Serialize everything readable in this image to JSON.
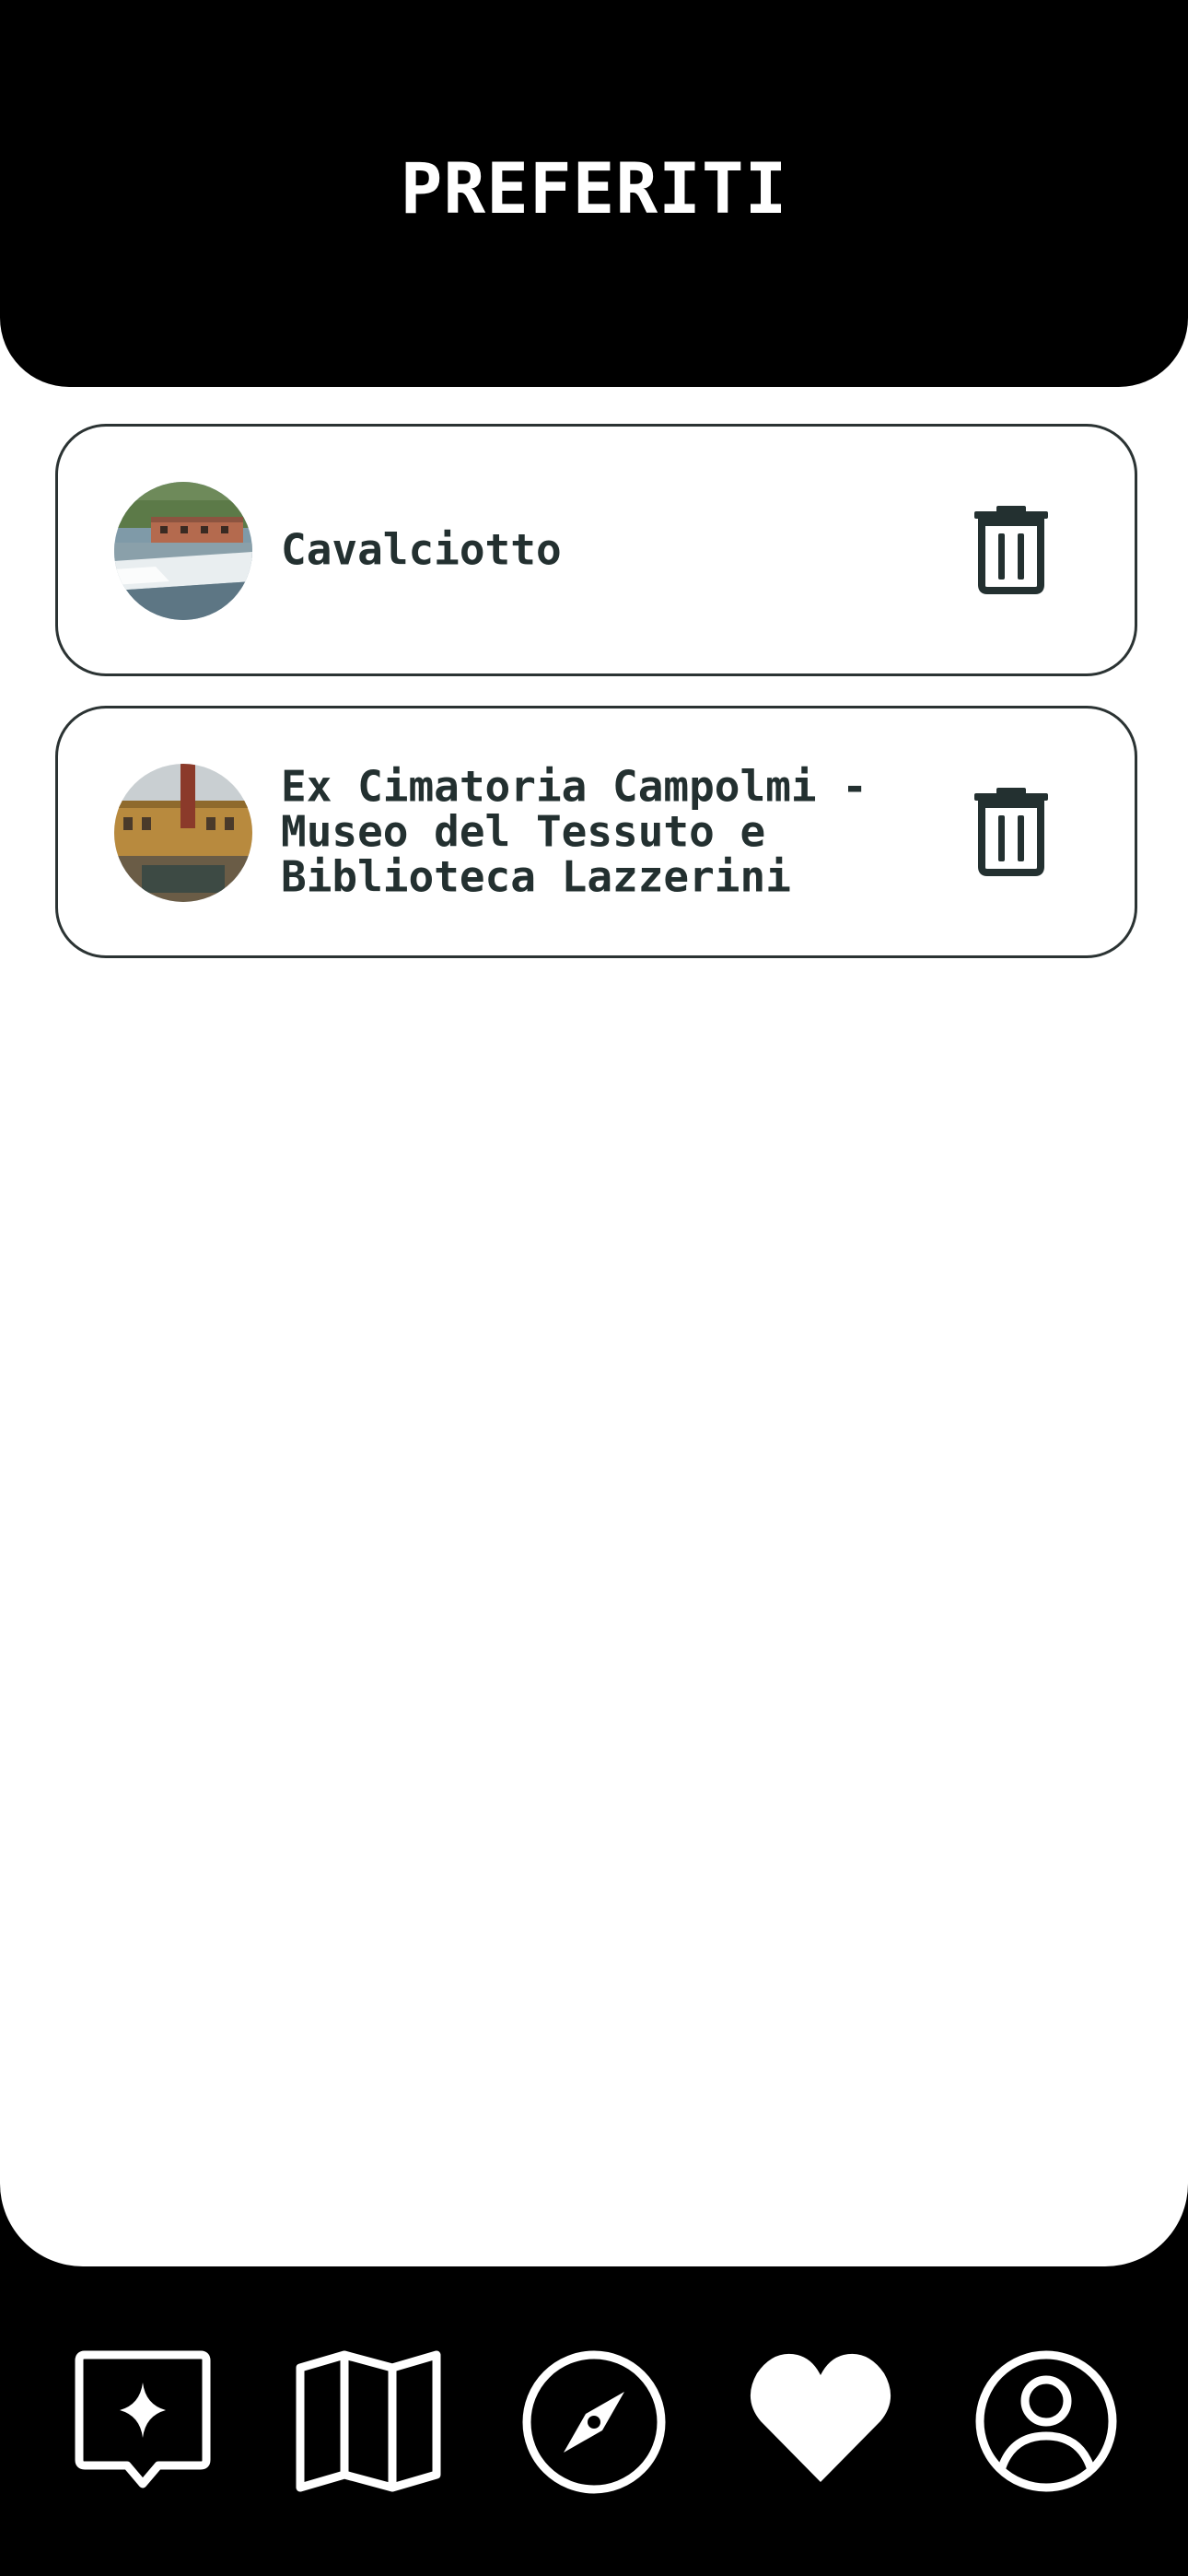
{
  "header": {
    "title": "PREFERITI"
  },
  "favorites": [
    {
      "name": "Cavalciotto",
      "thumbnail_icon": "photo-weir-river",
      "delete_icon": "trash-icon"
    },
    {
      "name": "Ex Cimatoria Campolmi - Museo del Tessuto e Biblioteca Lazzerini",
      "thumbnail_icon": "photo-factory-chimney",
      "delete_icon": "trash-icon"
    }
  ],
  "nav": {
    "items": [
      {
        "icon": "sparkle-chat-icon"
      },
      {
        "icon": "map-icon"
      },
      {
        "icon": "compass-icon"
      },
      {
        "icon": "heart-icon",
        "active": true
      },
      {
        "icon": "user-icon"
      }
    ]
  },
  "colors": {
    "background": "#000000",
    "surface": "#ffffff",
    "text": "#233030",
    "border": "#2b3333"
  }
}
